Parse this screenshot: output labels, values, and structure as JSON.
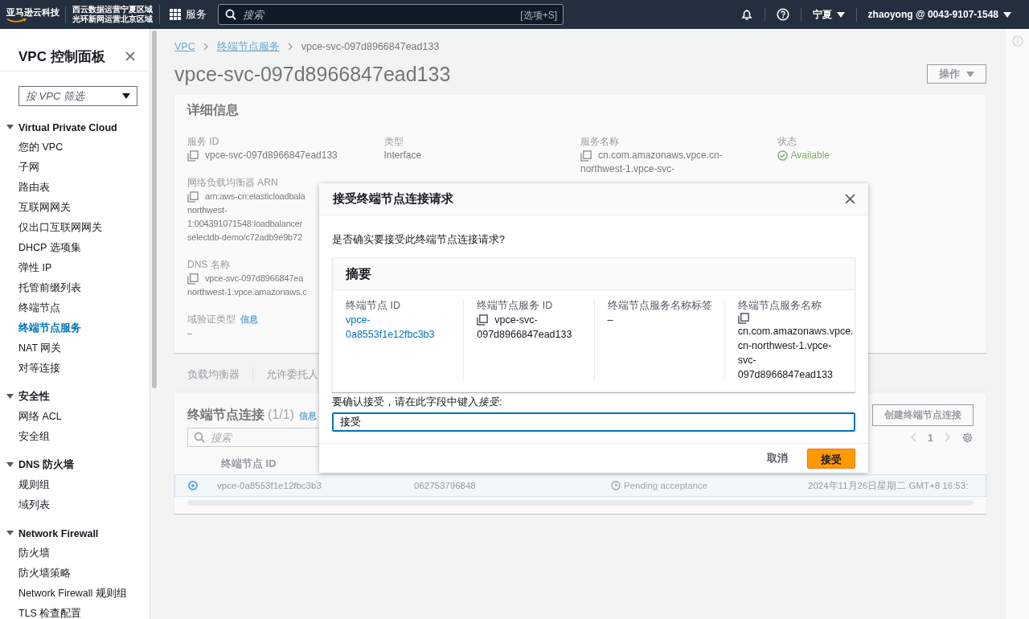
{
  "top_bar": {
    "logo": "亚马逊云科技",
    "operators": [
      "西云数据运营宁夏区域",
      "光环新网运营北京区域"
    ],
    "services": "服务",
    "search": {
      "placeholder": "搜索",
      "shortcut": "[选项+S]"
    },
    "region": "宁夏",
    "account": "zhaoyong @ 0043-9107-1548"
  },
  "sidebar": {
    "title": "VPC 控制面板",
    "filter": {
      "placeholder": "按 VPC 筛选"
    },
    "sections": [
      {
        "title": "Virtual Private Cloud",
        "expanded": true,
        "items": [
          {
            "label": "您的 VPC",
            "selected": false
          },
          {
            "label": "子网",
            "selected": false
          },
          {
            "label": "路由表",
            "selected": false
          },
          {
            "label": "互联网网关",
            "selected": false
          },
          {
            "label": "仅出口互联网网关",
            "selected": false
          },
          {
            "label": "DHCP 选项集",
            "selected": false
          },
          {
            "label": "弹性 IP",
            "selected": false
          },
          {
            "label": "托管前缀列表",
            "selected": false
          },
          {
            "label": "终端节点",
            "selected": false
          },
          {
            "label": "终端节点服务",
            "selected": true
          },
          {
            "label": "NAT 网关",
            "selected": false
          },
          {
            "label": "对等连接",
            "selected": false
          }
        ]
      },
      {
        "title": "安全性",
        "expanded": true,
        "items": [
          {
            "label": "网络 ACL",
            "selected": false
          },
          {
            "label": "安全组",
            "selected": false
          }
        ]
      },
      {
        "title": "DNS 防火墙",
        "expanded": true,
        "items": [
          {
            "label": "规则组",
            "selected": false
          },
          {
            "label": "域列表",
            "selected": false
          }
        ]
      },
      {
        "title": "Network Firewall",
        "expanded": true,
        "items": [
          {
            "label": "防火墙",
            "selected": false
          },
          {
            "label": "防火墙策略",
            "selected": false
          },
          {
            "label": "Network Firewall 规则组",
            "selected": false
          },
          {
            "label": "TLS 检查配置",
            "selected": false
          }
        ]
      }
    ]
  },
  "breadcrumb": [
    {
      "label": "VPC",
      "kind": "link"
    },
    {
      "label": "终端节点服务",
      "kind": "link"
    },
    {
      "label": "vpce-svc-097d8966847ead133",
      "kind": "current"
    }
  ],
  "page_title": "vpce-svc-097d8966847ead133",
  "actions_button": "操作",
  "details": {
    "title": "详细信息",
    "fields": [
      {
        "label": "服务 ID",
        "kind": "copy",
        "lines": [
          "vpce-svc-097d8966847ead133"
        ]
      },
      {
        "label": "类型",
        "kind": "text",
        "lines": [
          "Interface"
        ]
      },
      {
        "label": "服务名称",
        "kind": "copy",
        "lines": [
          "cn.com.amazonaws.vpce.cn-",
          "northwest-1.vpce-svc-"
        ]
      },
      {
        "label": "状态",
        "kind": "status",
        "lines": [
          "Available"
        ]
      },
      {
        "label": "网络负载均衡器 ARN",
        "kind": "copy",
        "lines": [
          "arn:aws-cn:elasticloadbala",
          "northwest-",
          "1:004391071548:loadbalancer",
          "selectdb-demo/c72adb9e9b72"
        ]
      },
      {
        "label": "DNS 名称",
        "kind": "copy",
        "lines": [
          "vpce-svc-097d8966847ea",
          "northwest-1.vpce.amazonaws.c"
        ]
      },
      {
        "label": "域验证类型",
        "kind": "text",
        "info": "信息",
        "lines": [
          "–"
        ]
      }
    ]
  },
  "tabs": [
    "负载均衡器",
    "允许委托人"
  ],
  "connections": {
    "title": "终端节点连接",
    "count": "(1/1)",
    "info": "信息",
    "search": {
      "placeholder": "搜索"
    },
    "create_button": "创建终端节点连接",
    "page": "1",
    "columns": [
      "终端节点 ID"
    ],
    "rows": [
      {
        "selected": true,
        "cells": [
          "vpce-0a8553f1e12fbc3b3",
          "062753796848",
          "Pending acceptance",
          "2024年11月26日星期二 GMT+8 16:53:"
        ]
      }
    ]
  },
  "modal": {
    "title": "接受终端节点连接请求",
    "question": "是否确实要接受此终端节点连接请求?",
    "summary": {
      "title": "摘要",
      "columns": [
        {
          "label": "终端节点 ID",
          "kind": "link",
          "lines": [
            "vpce-",
            "0a8553f1e12fbc3b3"
          ]
        },
        {
          "label": "终端节点服务 ID",
          "kind": "copy",
          "lines": [
            "vpce-svc-",
            "097d8966847ead133"
          ]
        },
        {
          "label": "终端节点服务名称标签",
          "kind": "text",
          "lines": [
            "–"
          ]
        },
        {
          "label": "终端节点服务名称",
          "kind": "copy",
          "lines": [
            "cn.com.amazonaws.vpce.",
            "cn-northwest-1.vpce-",
            "svc-",
            "097d8966847ead133"
          ]
        }
      ]
    },
    "confirm_label": {
      "text": "要确认接受，请在此字段中键入",
      "emphasis": "接受",
      "end": ":"
    },
    "confirm_value": "接受",
    "buttons": [
      {
        "label": "取消",
        "kind": "link"
      },
      {
        "label": "接受",
        "kind": "primary"
      }
    ]
  }
}
